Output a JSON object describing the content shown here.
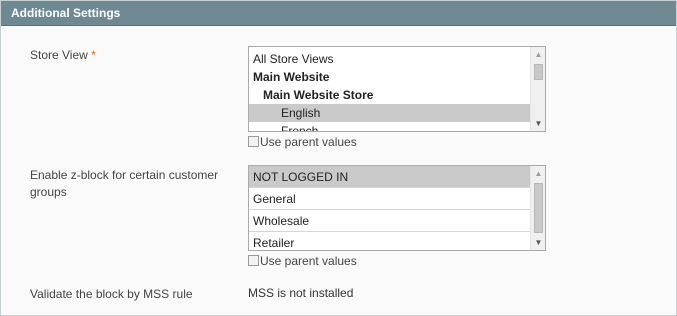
{
  "section": {
    "title": "Additional Settings"
  },
  "store_view": {
    "label": "Store View",
    "required_mark": "*",
    "options": [
      {
        "label": "All Store Views",
        "type": "option",
        "selected": false
      },
      {
        "label": "Main Website",
        "type": "group-level-1",
        "selected": false
      },
      {
        "label": "Main Website Store",
        "type": "group-level-2",
        "selected": false
      },
      {
        "label": "English",
        "type": "option-level-3",
        "selected": true
      },
      {
        "label": "French",
        "type": "option-level-3",
        "selected": false
      }
    ],
    "use_parent_label": "Use parent values",
    "use_parent_checked": false
  },
  "customer_groups": {
    "label": "Enable z-block for certain customer groups",
    "options": [
      {
        "label": "NOT LOGGED IN",
        "selected": true
      },
      {
        "label": "General",
        "selected": false
      },
      {
        "label": "Wholesale",
        "selected": false
      },
      {
        "label": "Retailer",
        "selected": false
      }
    ],
    "use_parent_label": "Use parent values",
    "use_parent_checked": false
  },
  "mss_rule": {
    "label": "Validate the block by MSS rule",
    "value": "MSS is not installed"
  },
  "colors": {
    "header_bg": "#6f8992",
    "selected_option_bg": "#cacaca",
    "required_mark": "#eb5e00"
  }
}
